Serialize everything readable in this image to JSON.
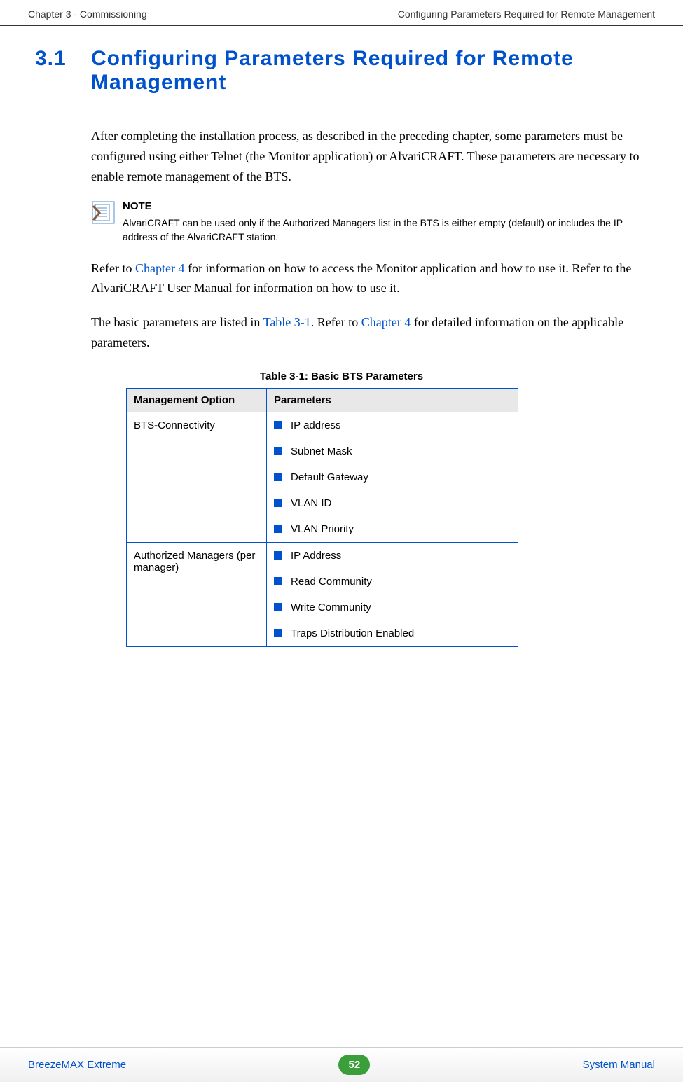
{
  "header": {
    "left": "Chapter 3 - Commissioning",
    "right": "Configuring Parameters Required for Remote Management"
  },
  "section": {
    "number": "3.1",
    "title": "Configuring Parameters Required for Remote Management"
  },
  "paragraphs": {
    "p1": "After completing the installation process, as described in the preceding chapter, some parameters must be configured using either Telnet (the Monitor application) or AlvariCRAFT. These parameters are necessary to enable remote management of the BTS.",
    "p2a": "Refer to ",
    "p2link1": "Chapter 4",
    "p2b": " for information on how to access the Monitor application and how to use it. Refer to the AlvariCRAFT User Manual for information on how to use it.",
    "p3a": "The basic parameters are listed in ",
    "p3link1": "Table 3-1",
    "p3b": ". Refer to ",
    "p3link2": "Chapter 4",
    "p3c": " for detailed information on the applicable parameters."
  },
  "note": {
    "label": "NOTE",
    "text": "AlvariCRAFT can be used only if the Authorized Managers list in the BTS is either empty (default) or includes the IP address of the AlvariCRAFT station."
  },
  "table": {
    "caption": "Table 3-1: Basic BTS Parameters",
    "headers": {
      "col1": "Management Option",
      "col2": "Parameters"
    },
    "rows": [
      {
        "option": "BTS-Connectivity",
        "params": [
          "IP address",
          "Subnet Mask",
          "Default Gateway",
          "VLAN ID",
          "VLAN Priority"
        ]
      },
      {
        "option": "Authorized Managers (per manager)",
        "params": [
          "IP Address",
          "Read Community",
          "Write Community",
          "Traps Distribution Enabled"
        ]
      }
    ]
  },
  "footer": {
    "left": "BreezeMAX Extreme",
    "page": "52",
    "right": "System Manual"
  }
}
